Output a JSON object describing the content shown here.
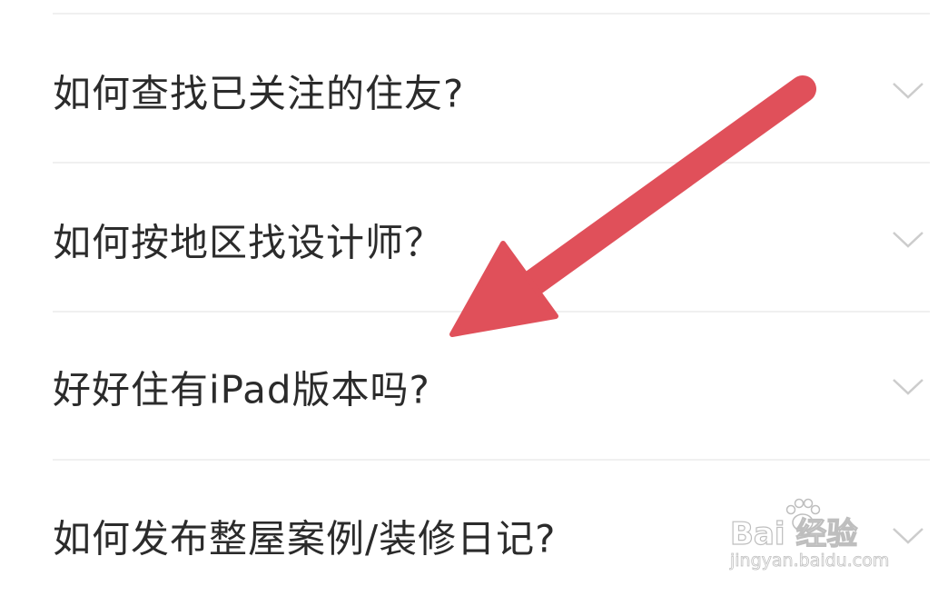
{
  "faq": {
    "items": [
      {
        "question": "如何查找已关注的住友?",
        "icon": "chevron-down-icon"
      },
      {
        "question": "如何按地区找设计师？",
        "icon": "chevron-down-icon"
      },
      {
        "question": "好好住有iPad版本吗?",
        "icon": "chevron-down-icon"
      },
      {
        "question": "如何发布整屋案例/装修日记?",
        "icon": "chevron-down-icon"
      }
    ]
  },
  "annotation": {
    "icon": "red-arrow-icon",
    "color": "#e0505a"
  },
  "watermark": {
    "brand": "Bai 经验",
    "url": "jingyan.baidu.com"
  },
  "colors": {
    "text": "#2b2b2b",
    "divider": "#f0f0f0",
    "chevron": "#cccccc"
  }
}
